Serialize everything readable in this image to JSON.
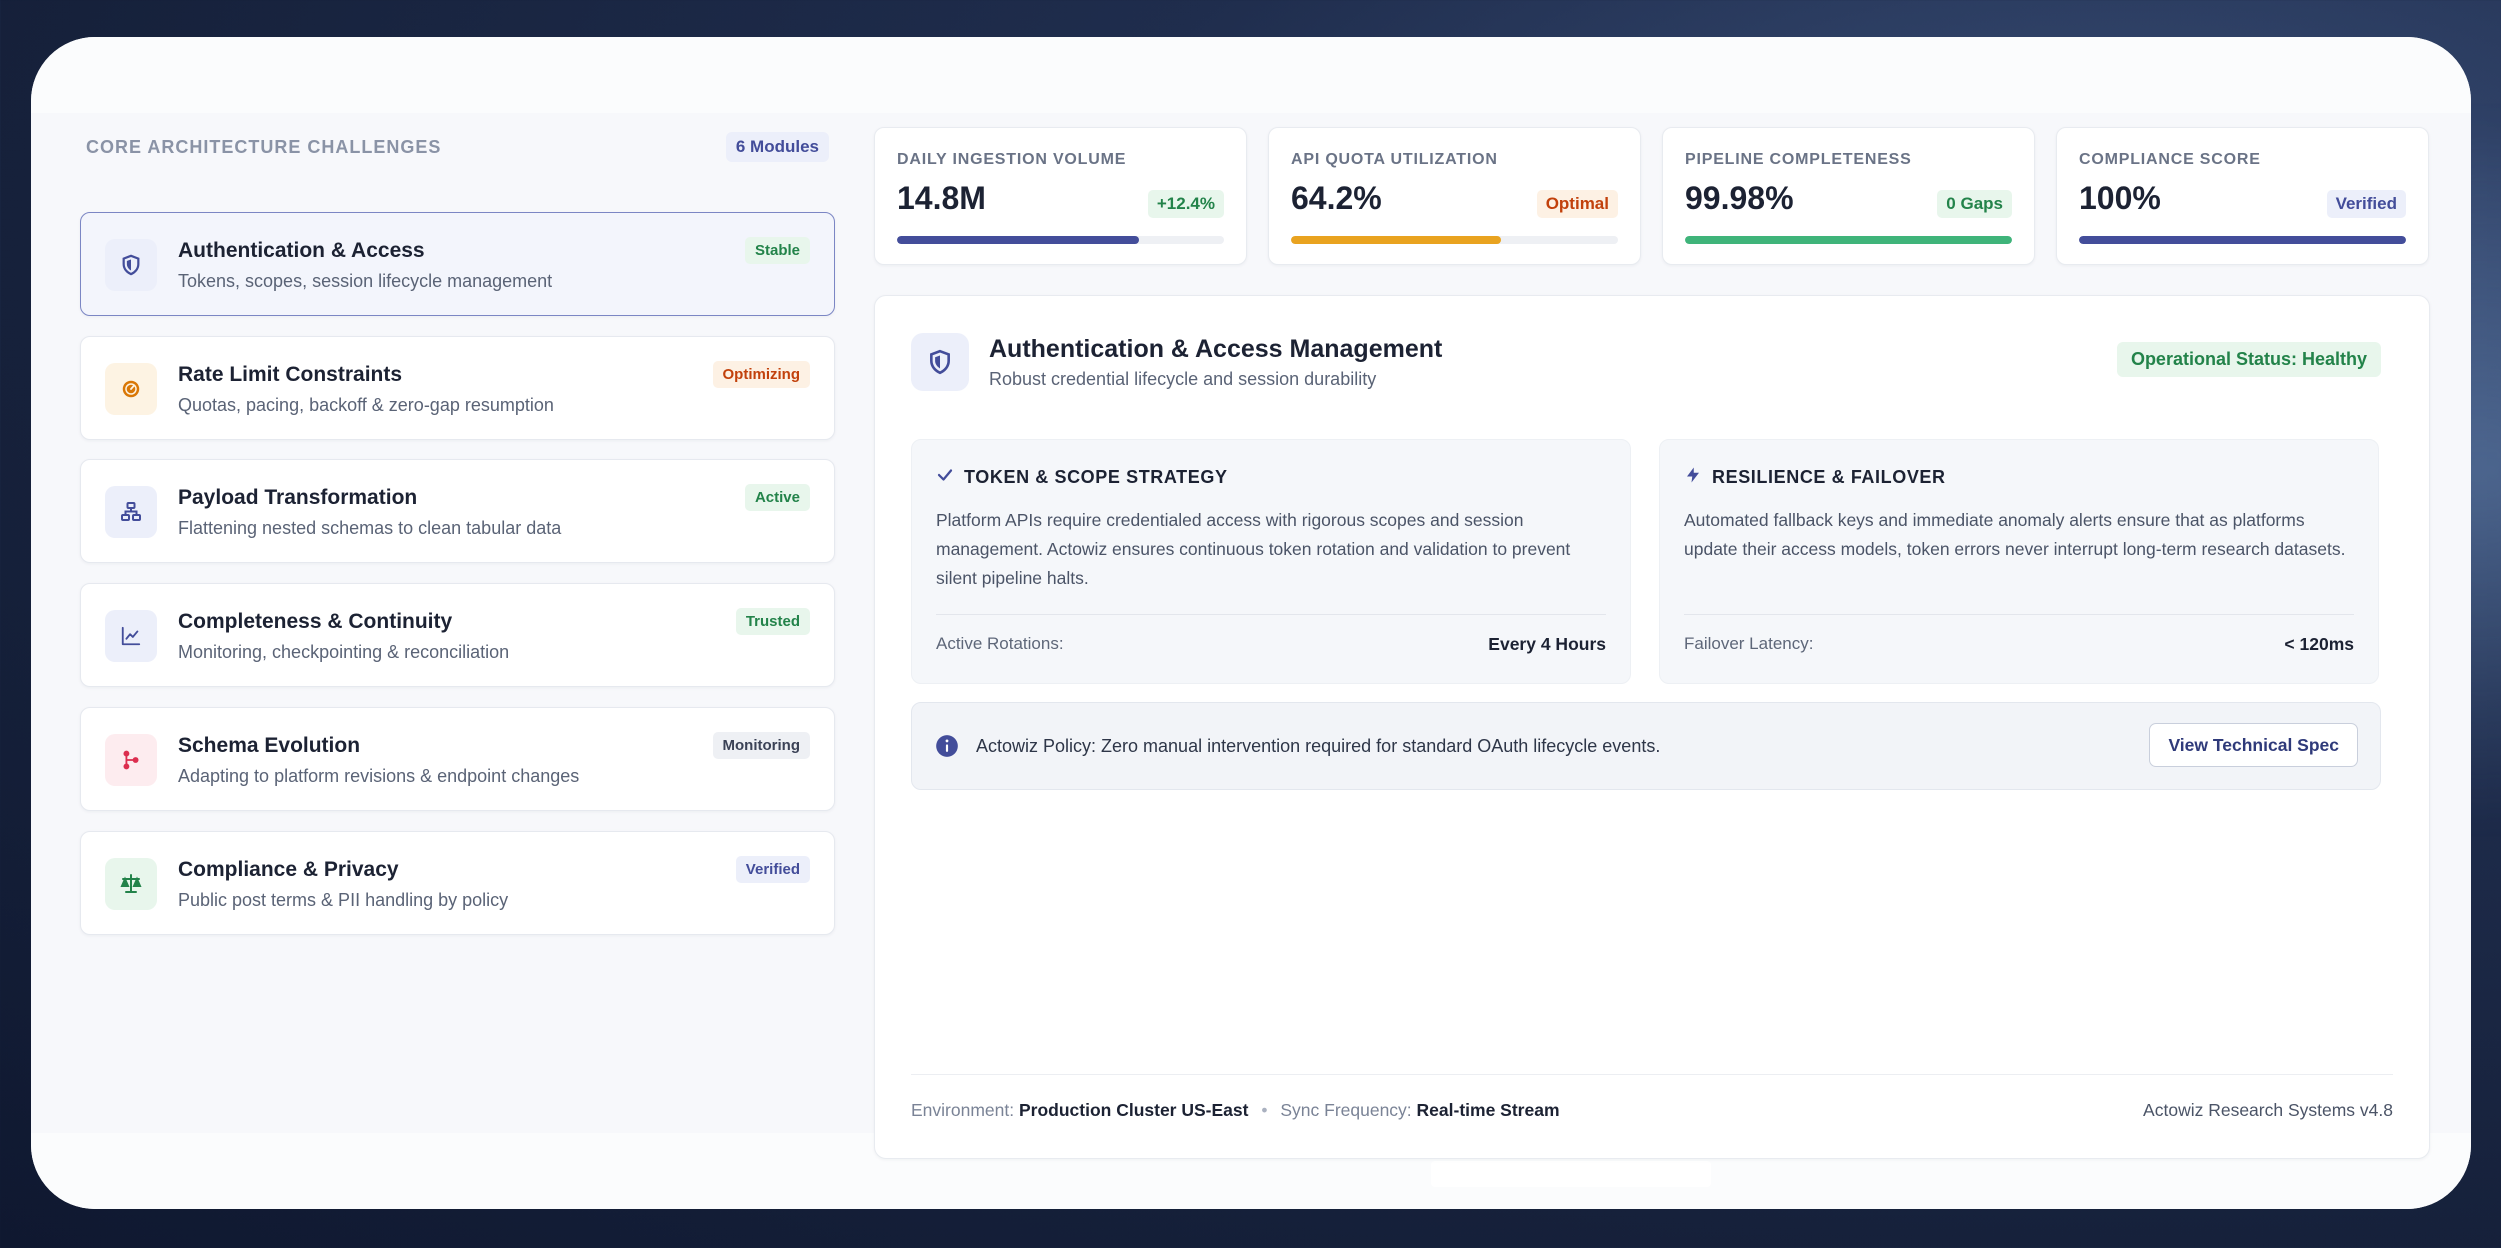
{
  "sidebar": {
    "section_title": "CORE ARCHITECTURE CHALLENGES",
    "modules_badge": "6 Modules",
    "items": [
      {
        "title": "Authentication & Access",
        "subtitle": "Tokens, scopes, session lifecycle management",
        "badge": "Stable",
        "icon": "shield-icon",
        "badge_color": "#23834a",
        "badge_bg": "#e8f6ec",
        "icon_color": "#434d9a",
        "icon_bg": "#eceffa"
      },
      {
        "title": "Rate Limit Constraints",
        "subtitle": "Quotas, pacing, backoff & zero-gap resumption",
        "badge": "Optimizing",
        "icon": "gauge-icon",
        "badge_color": "#c2410c",
        "badge_bg": "#fdf1e4",
        "icon_color": "#d97706",
        "icon_bg": "#fdf3e3"
      },
      {
        "title": "Payload Transformation",
        "subtitle": "Flattening nested schemas to clean tabular data",
        "badge": "Active",
        "icon": "hierarchy-icon",
        "badge_color": "#23834a",
        "badge_bg": "#e8f6ec",
        "icon_color": "#434d9a",
        "icon_bg": "#eceffa"
      },
      {
        "title": "Completeness & Continuity",
        "subtitle": "Monitoring, checkpointing & reconciliation",
        "badge": "Trusted",
        "icon": "trend-chart-icon",
        "badge_color": "#23834a",
        "badge_bg": "#e8f6ec",
        "icon_color": "#434d9a",
        "icon_bg": "#eceffa"
      },
      {
        "title": "Schema Evolution",
        "subtitle": "Adapting to platform revisions & endpoint changes",
        "badge": "Monitoring",
        "icon": "git-branch-icon",
        "badge_color": "#3b4256",
        "badge_bg": "#eef0f4",
        "icon_color": "#dc2e4f",
        "icon_bg": "#fdecef"
      },
      {
        "title": "Compliance & Privacy",
        "subtitle": "Public post terms & PII handling by policy",
        "badge": "Verified",
        "icon": "scale-icon",
        "badge_color": "#434d9a",
        "badge_bg": "#eceffa",
        "icon_color": "#23834a",
        "icon_bg": "#e8f6ec"
      }
    ]
  },
  "metrics": [
    {
      "label": "DAILY INGESTION VOLUME",
      "value": "14.8M",
      "badge": "+12.4%",
      "progress": 0.74,
      "color": "#434d9a",
      "badge_color": "#23834a",
      "badge_bg": "#e8f6ec"
    },
    {
      "label": "API QUOTA UTILIZATION",
      "value": "64.2%",
      "badge": "Optimal",
      "progress": 0.642,
      "color": "#e9a320",
      "badge_color": "#c2410c",
      "badge_bg": "#fdf1e4"
    },
    {
      "label": "PIPELINE COMPLETENESS",
      "value": "99.98%",
      "badge": "0 Gaps",
      "progress": 0.9998,
      "color": "#3fb47a",
      "badge_color": "#23834a",
      "badge_bg": "#e8f6ec"
    },
    {
      "label": "COMPLIANCE SCORE",
      "value": "100%",
      "badge": "Verified",
      "progress": 1.0,
      "color": "#434d9a",
      "badge_color": "#434d9a",
      "badge_bg": "#eceffa"
    }
  ],
  "detail": {
    "title": "Authentication & Access Management",
    "subtitle": "Robust credential lifecycle and session durability",
    "status": "Operational Status: Healthy",
    "panels": [
      {
        "heading": "TOKEN & SCOPE STRATEGY",
        "icon": "check-icon",
        "body": "Platform APIs require credentialed access with rigorous scopes and session management. Actowiz ensures continuous token rotation and validation to prevent silent pipeline halts.",
        "row_label": "Active Rotations:",
        "row_value": "Every 4 Hours"
      },
      {
        "heading": "RESILIENCE & FAILOVER",
        "icon": "bolt-icon",
        "body": "Automated fallback keys and immediate anomaly alerts ensure that as platforms update their access models, token errors never interrupt long-term research datasets.",
        "row_label": "Failover Latency:",
        "row_value": "< 120ms"
      }
    ],
    "policy_text": "Actowiz Policy: Zero manual intervention required for standard OAuth lifecycle events.",
    "policy_button": "View Technical Spec",
    "footer": {
      "env_label": "Environment:",
      "env_value": "Production Cluster US-East",
      "sync_label": "Sync Frequency:",
      "sync_value": "Real-time Stream",
      "version": "Actowiz Research Systems v4.8"
    }
  }
}
